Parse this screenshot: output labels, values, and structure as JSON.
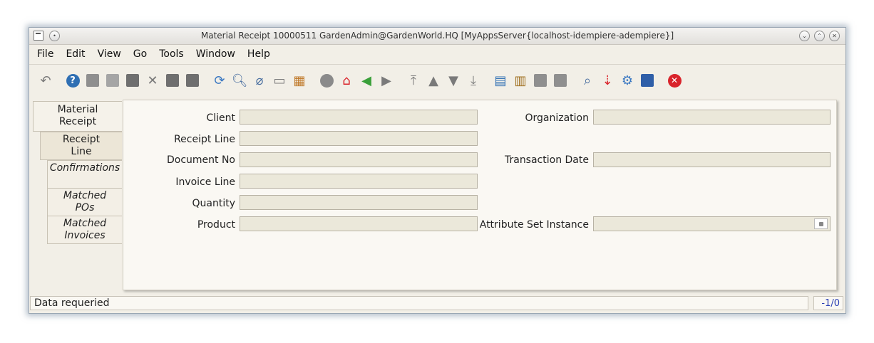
{
  "window": {
    "title": "Material Receipt  10000511  GardenAdmin@GardenWorld.HQ [MyAppsServer{localhost-idempiere-adempiere}]"
  },
  "menu": {
    "file": "File",
    "edit": "Edit",
    "view": "View",
    "go": "Go",
    "tools": "Tools",
    "window": "Window",
    "help": "Help"
  },
  "toolbar_icons": [
    "undo-icon",
    "help-icon",
    "new-record-icon",
    "copy-record-icon",
    "delete-icon",
    "delete-selection-icon",
    "save-icon",
    "save-and-new-icon",
    "refresh-icon",
    "find-icon",
    "attachment-icon",
    "chat-icon",
    "grid-toggle-icon",
    "history-icon",
    "home-icon",
    "parent-icon",
    "detail-icon",
    "first-record-icon",
    "previous-record-icon",
    "next-record-icon",
    "last-record-icon",
    "report-icon",
    "archive-icon",
    "print-preview-icon",
    "print-icon",
    "zoom-across-icon",
    "request-icon",
    "workflow-icon",
    "product-info-icon",
    "close-window-icon"
  ],
  "tabs": [
    {
      "label_line1": "Material",
      "label_line2": "Receipt"
    },
    {
      "label_line1": "Receipt",
      "label_line2": "Line"
    },
    {
      "label_line1": "Confirmations",
      "label_line2": ""
    },
    {
      "label_line1": "Matched",
      "label_line2": "POs"
    },
    {
      "label_line1": "Matched",
      "label_line2": "Invoices"
    }
  ],
  "form": {
    "client": {
      "label": "Client",
      "value": ""
    },
    "organization": {
      "label": "Organization",
      "value": ""
    },
    "receipt_line": {
      "label": "Receipt Line",
      "value": ""
    },
    "document_no": {
      "label": "Document No",
      "value": ""
    },
    "transaction_date": {
      "label": "Transaction Date",
      "value": ""
    },
    "invoice_line": {
      "label": "Invoice Line",
      "value": ""
    },
    "quantity": {
      "label": "Quantity",
      "value": ""
    },
    "product": {
      "label": "Product",
      "value": ""
    },
    "attribute_set_instance": {
      "label": "Attribute Set Instance",
      "value": ""
    }
  },
  "status": {
    "message": "Data requeried",
    "record_count": "-1/0"
  },
  "colors": {
    "window_bg": "#f2efe7",
    "field_bg": "#ebe8da",
    "record_count": "#2a3fb5",
    "close_red": "#d9242b",
    "help_blue": "#2f6fb3"
  }
}
